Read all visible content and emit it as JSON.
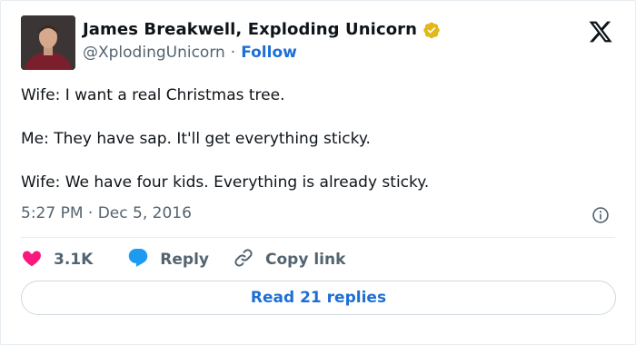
{
  "author": {
    "display_name": "James Breakwell, Exploding Unicorn",
    "handle": "@XplodingUnicorn",
    "separator": "·",
    "follow_label": "Follow",
    "verified_badge_color": "#e2b719"
  },
  "tweet": {
    "lines": [
      "Wife: I want a real Christmas tree.",
      "Me: They have sap. It'll get everything sticky.",
      "Wife: We have four kids. Everything is already sticky."
    ],
    "timestamp": "5:27 PM · Dec 5, 2016"
  },
  "actions": {
    "like_count": "3.1K",
    "reply_label": "Reply",
    "copy_link_label": "Copy link"
  },
  "read_replies_label": "Read 21 replies",
  "colors": {
    "like": "#f91880",
    "reply": "#1d9bf0",
    "link": "#1d6fd6",
    "muted": "#536471"
  },
  "icons": {
    "logo": "x-logo-icon",
    "verified": "verified-badge-icon",
    "info": "info-icon",
    "like": "heart-icon",
    "reply": "speech-bubble-icon",
    "copy_link": "link-icon"
  }
}
